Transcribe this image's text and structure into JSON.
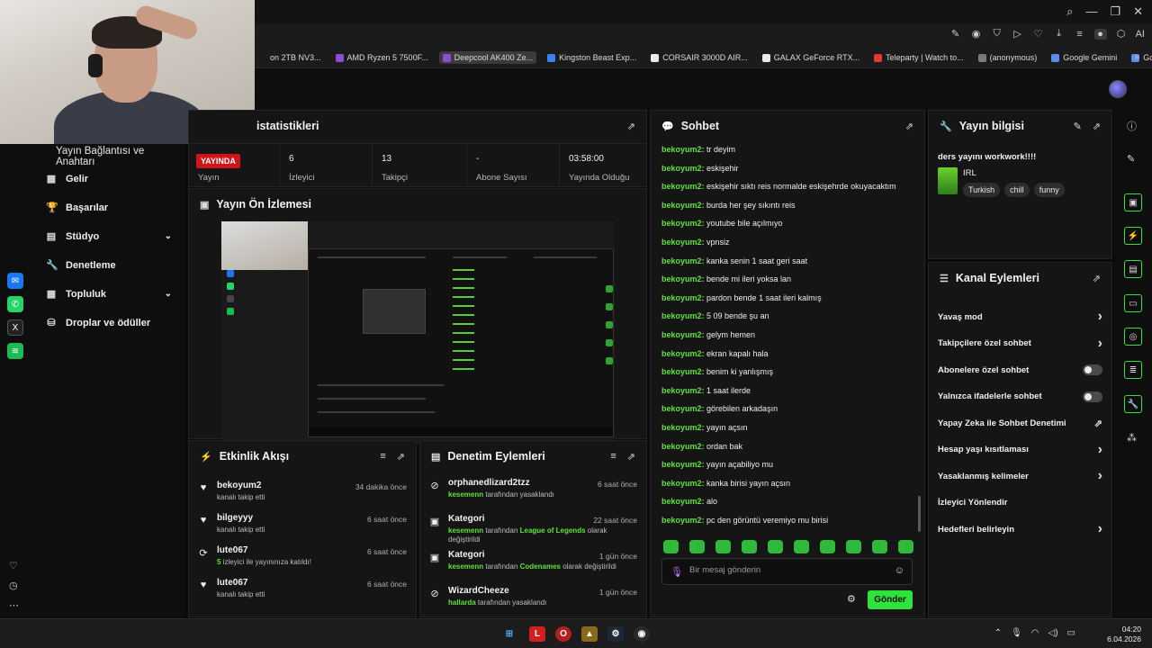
{
  "browser": {
    "bookmarks": [
      {
        "label": "on 2TB NV3...",
        "color": "#1b1b1b"
      },
      {
        "label": "AMD Ryzen 5 7500F...",
        "color": "#8a4fd8"
      },
      {
        "label": "Deepcool AK400 Ze...",
        "color": "#8a4fd8",
        "active": true
      },
      {
        "label": "Kingston Beast Exp...",
        "color": "#3b82f6"
      },
      {
        "label": "CORSAIR 3000D AIR...",
        "color": "#eaeaea"
      },
      {
        "label": "GALAX GeForce RTX...",
        "color": "#eaeaea"
      },
      {
        "label": "Teleparty | Watch to...",
        "color": "#e53935"
      },
      {
        "label": "(anonymous)",
        "color": "#7a7a7a"
      },
      {
        "label": "Google Gemini",
        "color": "#5b8def"
      },
      {
        "label": "Google Gemini",
        "color": "#5b8def"
      }
    ],
    "ai_label": "AI"
  },
  "sidebar": {
    "heading": "Yayın Bağlantısı ve Anahtarı",
    "items": [
      {
        "label": "Gelir",
        "icon": "▦"
      },
      {
        "label": "Başarılar",
        "icon": "🏆"
      },
      {
        "label": "Stüdyo",
        "icon": "▤",
        "expandable": true
      },
      {
        "label": "Denetleme",
        "icon": "🔧"
      },
      {
        "label": "Topluluk",
        "icon": "▦",
        "expandable": true
      },
      {
        "label": "Droplar ve ödüller",
        "icon": "⛁"
      }
    ]
  },
  "stats": {
    "title": "istatistikleri",
    "live_badge": "YAYINDA",
    "cells": [
      {
        "value": "",
        "label": "Yayın"
      },
      {
        "value": "6",
        "label": "İzleyici"
      },
      {
        "value": "13",
        "label": "Takipçi"
      },
      {
        "value": "-",
        "label": "Abone Sayısı"
      },
      {
        "value": "03:58:00",
        "label": "Yayında Olduğu"
      }
    ]
  },
  "preview": {
    "title": "Yayın Ön İzlemesi"
  },
  "activity": {
    "title": "Etkinlik Akışı",
    "items": [
      {
        "name": "bekoyum2",
        "desc": "kanalı takip etti",
        "time": "34 dakika önce",
        "icon": "heart"
      },
      {
        "name": "bilgeyyy",
        "desc": "kanalı takip etti",
        "time": "6 saat önce",
        "icon": "heart"
      },
      {
        "name": "lute067",
        "desc_highlight": "5",
        "desc": " izleyici ile yayınınıza katıldı!",
        "time": "6 saat önce",
        "icon": "raid"
      },
      {
        "name": "lute067",
        "desc": "kanalı takip etti",
        "time": "6 saat önce",
        "icon": "heart"
      }
    ]
  },
  "moderation": {
    "title": "Denetim Eylemleri",
    "items": [
      {
        "name": "orphanedlizard2tzz",
        "actor": "kesemenn",
        "desc": " tarafından yasaklandı",
        "time": "6 saat önce",
        "icon": "ban"
      },
      {
        "name": "Kategori",
        "actor": "kesemenn",
        "desc": " tarafından ",
        "value": "League of Legends",
        "desc2": " olarak",
        "desc3": "değiştirildi",
        "time": "22 saat önce",
        "icon": "category"
      },
      {
        "name": "Kategori",
        "actor": "kesemenn",
        "desc": " tarafından ",
        "value": "Codenames",
        "desc2": " olarak değiştirildi",
        "desc3": "",
        "time": "1 gün önce",
        "icon": "category"
      },
      {
        "name": "WizardCheeze",
        "actor": "hallarda",
        "desc": " tarafından yasaklandı",
        "time": "1 gün önce",
        "icon": "ban"
      }
    ]
  },
  "chat": {
    "title": "Sohbet",
    "messages": [
      {
        "user": "bekoyum2:",
        "text": " tr deyim"
      },
      {
        "user": "bekoyum2:",
        "text": " eskişehir"
      },
      {
        "user": "bekoyum2:",
        "text": " eskişehir sıktı reis normalde eskişehrde okuyacaktım"
      },
      {
        "user": "bekoyum2:",
        "text": " burda her şey sıkıntı reis"
      },
      {
        "user": "bekoyum2:",
        "text": " youtube bile açılmıyo"
      },
      {
        "user": "bekoyum2:",
        "text": " vpnsiz"
      },
      {
        "user": "bekoyum2:",
        "text": " kanka senin 1 saat geri saat"
      },
      {
        "user": "bekoyum2:",
        "text": " bende mi ileri yoksa lan"
      },
      {
        "user": "bekoyum2:",
        "text": " pardon bende 1 saat ileri kalmış"
      },
      {
        "user": "bekoyum2:",
        "text": " 5 09 bende şu an"
      },
      {
        "user": "bekoyum2:",
        "text": " gelym hemen"
      },
      {
        "user": "bekoyum2:",
        "text": " ekran kapalı hala"
      },
      {
        "user": "bekoyum2:",
        "text": " benim ki yanlışmış"
      },
      {
        "user": "bekoyum2:",
        "text": " 1 saat ilerde"
      },
      {
        "user": "bekoyum2:",
        "text": " görebilen arkadaşın"
      },
      {
        "user": "bekoyum2:",
        "text": " yayın açsın"
      },
      {
        "user": "bekoyum2:",
        "text": " ordan bak"
      },
      {
        "user": "bekoyum2:",
        "text": " yayın açabiliyo mu"
      },
      {
        "user": "bekoyum2:",
        "text": " kanka birisi yayın açsın"
      },
      {
        "user": "bekoyum2:",
        "text": " alo"
      },
      {
        "user": "bekoyum2:",
        "text": " pc den görüntü veremiyo mu birisi"
      }
    ],
    "placeholder": "Bir mesaj gönderin",
    "send_label": "Gönder"
  },
  "stream_info": {
    "title": "Yayın bilgisi",
    "stream_title": "ders yayını workwork!!!!",
    "category": "IRL",
    "tags": [
      "Turkish",
      "chill",
      "funny"
    ]
  },
  "channel_actions": {
    "title": "Kanal Eylemleri",
    "items": [
      {
        "label": "Yavaş mod",
        "control": "chevron"
      },
      {
        "label": "Takipçilere özel sohbet",
        "control": "chevron"
      },
      {
        "label": "Abonelere özel sohbet",
        "control": "toggle"
      },
      {
        "label": "Yalnızca ifadelerle sohbet",
        "control": "toggle"
      },
      {
        "label": "Yapay Zeka ile Sohbet Denetimi",
        "control": "external"
      },
      {
        "label": "Hesap yaşı kısıtlaması",
        "control": "chevron"
      },
      {
        "label": "Yasaklanmış kelimeler",
        "control": "chevron"
      },
      {
        "label": "İzleyici Yönlendir",
        "control": "none"
      },
      {
        "label": "Hedefleri belirleyin",
        "control": "chevron"
      }
    ]
  },
  "taskbar": {
    "time": "04:20",
    "date": "6.04.2026"
  },
  "colors": {
    "accent_green": "#2ee33b",
    "username_green": "#5fe23e",
    "live_red": "#d0141a"
  }
}
